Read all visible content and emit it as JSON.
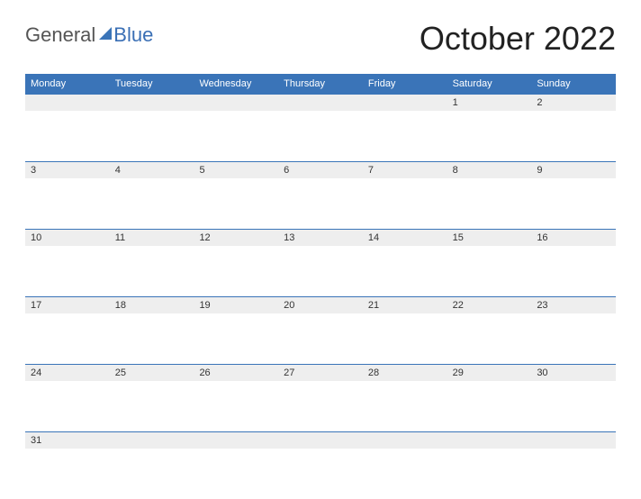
{
  "logo": {
    "word1": "General",
    "word2": "Blue"
  },
  "title": "October 2022",
  "headers": [
    "Monday",
    "Tuesday",
    "Wednesday",
    "Thursday",
    "Friday",
    "Saturday",
    "Sunday"
  ],
  "weeks": [
    [
      "",
      "",
      "",
      "",
      "",
      "1",
      "2"
    ],
    [
      "3",
      "4",
      "5",
      "6",
      "7",
      "8",
      "9"
    ],
    [
      "10",
      "11",
      "12",
      "13",
      "14",
      "15",
      "16"
    ],
    [
      "17",
      "18",
      "19",
      "20",
      "21",
      "22",
      "23"
    ],
    [
      "24",
      "25",
      "26",
      "27",
      "28",
      "29",
      "30"
    ],
    [
      "31",
      "",
      "",
      "",
      "",
      "",
      ""
    ]
  ]
}
